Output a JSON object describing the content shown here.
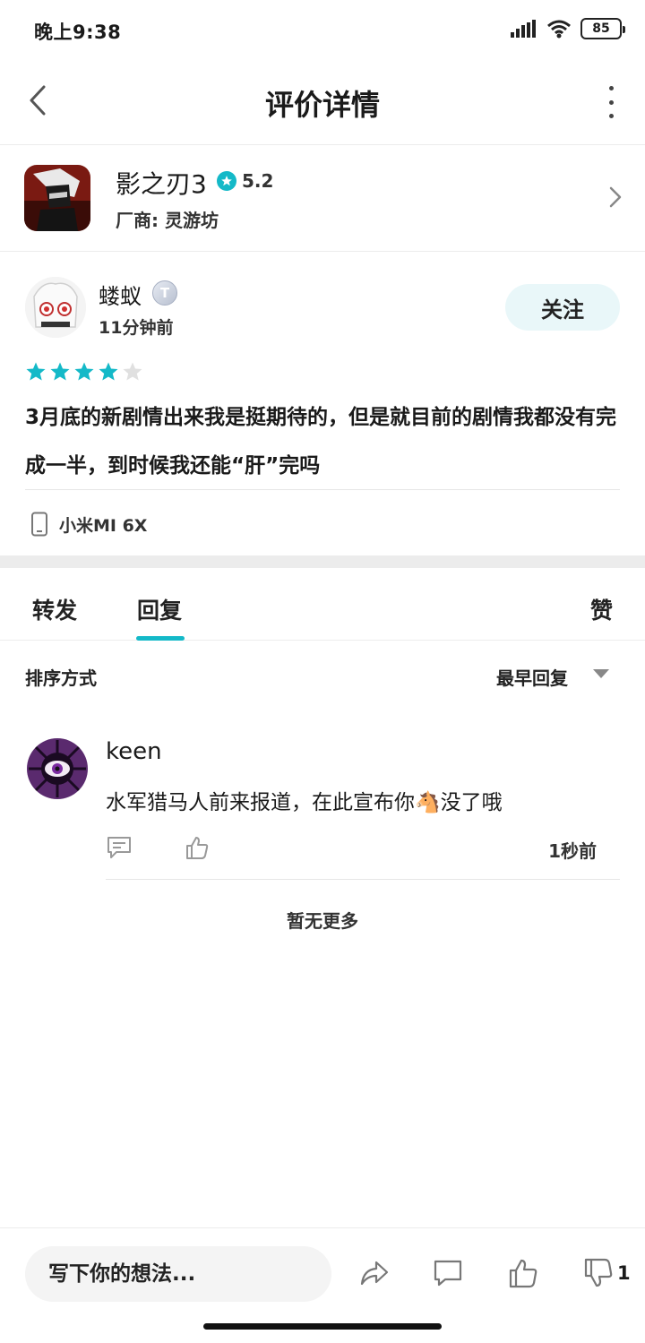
{
  "status_bar": {
    "time": "晚上9:38",
    "battery": "85"
  },
  "header": {
    "title": "评价详情"
  },
  "game": {
    "name": "影之刃3",
    "rating": "5.2",
    "vendor": "厂商: 灵游坊"
  },
  "review": {
    "user_name": "蝼蚁",
    "badge": "T",
    "time": "11分钟前",
    "follow_label": "关注",
    "stars": 4,
    "stars_max": 5,
    "text": "3月底的新剧情出来我是挺期待的，但是就目前的剧情我都没有完成一半，到时候我还能“肝”完吗",
    "device": "小米MI 6X"
  },
  "tabs": {
    "forward": "转发",
    "reply": "回复",
    "like": "赞"
  },
  "sort": {
    "label": "排序方式",
    "value": "最早回复"
  },
  "reply_item": {
    "user_name": "keen",
    "text": "水军猎马人前来报道，在此宣布你🐴没了哦",
    "time": "1秒前"
  },
  "no_more": "暂无更多",
  "bottom_bar": {
    "input_placeholder": "写下你的想法...",
    "dislike_count": "1"
  },
  "colors": {
    "accent": "#14b9c8",
    "divider": "#ececec"
  }
}
